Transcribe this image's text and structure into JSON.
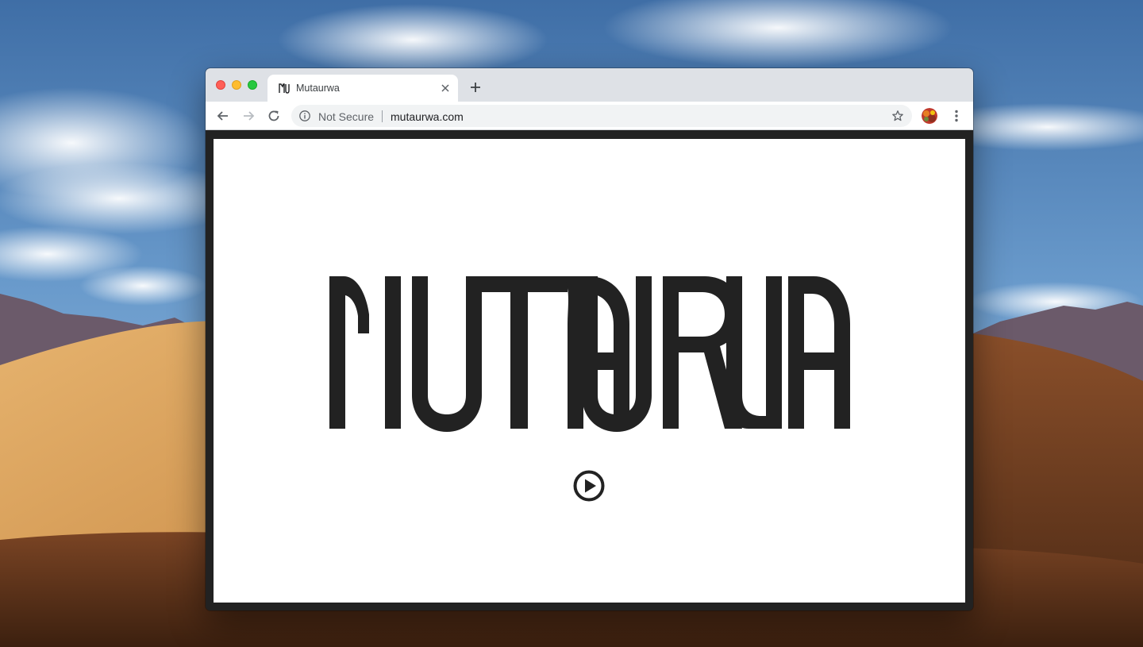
{
  "desktop": {
    "wallpaper_icon": "desert-dunes-wallpaper"
  },
  "browser": {
    "window_controls": {
      "close_color": "#ff5f57",
      "minimize_color": "#febc2e",
      "zoom_color": "#28c840"
    },
    "tab": {
      "favicon_icon": "mu-logo-icon",
      "title": "Mutaurwa",
      "close_icon": "close-icon"
    },
    "new_tab_icon": "plus-icon",
    "toolbar": {
      "back_icon": "arrow-left-icon",
      "forward_icon": "arrow-right-icon",
      "reload_icon": "reload-icon",
      "omnibox": {
        "info_icon": "info-icon",
        "security_label": "Not Secure",
        "url": "mutaurwa.com",
        "bookmark_icon": "star-icon"
      },
      "avatar_icon": "profile-avatar",
      "menu_icon": "vertical-dots-icon"
    }
  },
  "page": {
    "background_color": "#ffffff",
    "frame_color": "#222222",
    "logo_text": "MUTAURWA",
    "logo_color": "#222222",
    "play_icon": "play-circle-icon"
  }
}
